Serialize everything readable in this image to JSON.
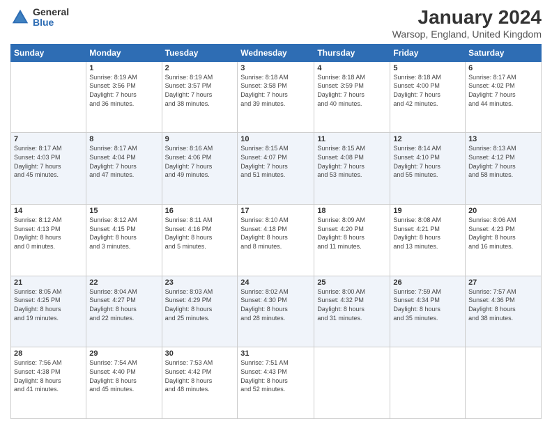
{
  "header": {
    "logo_general": "General",
    "logo_blue": "Blue",
    "month_title": "January 2024",
    "location": "Warsop, England, United Kingdom"
  },
  "days_of_week": [
    "Sunday",
    "Monday",
    "Tuesday",
    "Wednesday",
    "Thursday",
    "Friday",
    "Saturday"
  ],
  "weeks": [
    [
      {
        "day": "",
        "info": ""
      },
      {
        "day": "1",
        "info": "Sunrise: 8:19 AM\nSunset: 3:56 PM\nDaylight: 7 hours\nand 36 minutes."
      },
      {
        "day": "2",
        "info": "Sunrise: 8:19 AM\nSunset: 3:57 PM\nDaylight: 7 hours\nand 38 minutes."
      },
      {
        "day": "3",
        "info": "Sunrise: 8:18 AM\nSunset: 3:58 PM\nDaylight: 7 hours\nand 39 minutes."
      },
      {
        "day": "4",
        "info": "Sunrise: 8:18 AM\nSunset: 3:59 PM\nDaylight: 7 hours\nand 40 minutes."
      },
      {
        "day": "5",
        "info": "Sunrise: 8:18 AM\nSunset: 4:00 PM\nDaylight: 7 hours\nand 42 minutes."
      },
      {
        "day": "6",
        "info": "Sunrise: 8:17 AM\nSunset: 4:02 PM\nDaylight: 7 hours\nand 44 minutes."
      }
    ],
    [
      {
        "day": "7",
        "info": "Sunrise: 8:17 AM\nSunset: 4:03 PM\nDaylight: 7 hours\nand 45 minutes."
      },
      {
        "day": "8",
        "info": "Sunrise: 8:17 AM\nSunset: 4:04 PM\nDaylight: 7 hours\nand 47 minutes."
      },
      {
        "day": "9",
        "info": "Sunrise: 8:16 AM\nSunset: 4:06 PM\nDaylight: 7 hours\nand 49 minutes."
      },
      {
        "day": "10",
        "info": "Sunrise: 8:15 AM\nSunset: 4:07 PM\nDaylight: 7 hours\nand 51 minutes."
      },
      {
        "day": "11",
        "info": "Sunrise: 8:15 AM\nSunset: 4:08 PM\nDaylight: 7 hours\nand 53 minutes."
      },
      {
        "day": "12",
        "info": "Sunrise: 8:14 AM\nSunset: 4:10 PM\nDaylight: 7 hours\nand 55 minutes."
      },
      {
        "day": "13",
        "info": "Sunrise: 8:13 AM\nSunset: 4:12 PM\nDaylight: 7 hours\nand 58 minutes."
      }
    ],
    [
      {
        "day": "14",
        "info": "Sunrise: 8:12 AM\nSunset: 4:13 PM\nDaylight: 8 hours\nand 0 minutes."
      },
      {
        "day": "15",
        "info": "Sunrise: 8:12 AM\nSunset: 4:15 PM\nDaylight: 8 hours\nand 3 minutes."
      },
      {
        "day": "16",
        "info": "Sunrise: 8:11 AM\nSunset: 4:16 PM\nDaylight: 8 hours\nand 5 minutes."
      },
      {
        "day": "17",
        "info": "Sunrise: 8:10 AM\nSunset: 4:18 PM\nDaylight: 8 hours\nand 8 minutes."
      },
      {
        "day": "18",
        "info": "Sunrise: 8:09 AM\nSunset: 4:20 PM\nDaylight: 8 hours\nand 11 minutes."
      },
      {
        "day": "19",
        "info": "Sunrise: 8:08 AM\nSunset: 4:21 PM\nDaylight: 8 hours\nand 13 minutes."
      },
      {
        "day": "20",
        "info": "Sunrise: 8:06 AM\nSunset: 4:23 PM\nDaylight: 8 hours\nand 16 minutes."
      }
    ],
    [
      {
        "day": "21",
        "info": "Sunrise: 8:05 AM\nSunset: 4:25 PM\nDaylight: 8 hours\nand 19 minutes."
      },
      {
        "day": "22",
        "info": "Sunrise: 8:04 AM\nSunset: 4:27 PM\nDaylight: 8 hours\nand 22 minutes."
      },
      {
        "day": "23",
        "info": "Sunrise: 8:03 AM\nSunset: 4:29 PM\nDaylight: 8 hours\nand 25 minutes."
      },
      {
        "day": "24",
        "info": "Sunrise: 8:02 AM\nSunset: 4:30 PM\nDaylight: 8 hours\nand 28 minutes."
      },
      {
        "day": "25",
        "info": "Sunrise: 8:00 AM\nSunset: 4:32 PM\nDaylight: 8 hours\nand 31 minutes."
      },
      {
        "day": "26",
        "info": "Sunrise: 7:59 AM\nSunset: 4:34 PM\nDaylight: 8 hours\nand 35 minutes."
      },
      {
        "day": "27",
        "info": "Sunrise: 7:57 AM\nSunset: 4:36 PM\nDaylight: 8 hours\nand 38 minutes."
      }
    ],
    [
      {
        "day": "28",
        "info": "Sunrise: 7:56 AM\nSunset: 4:38 PM\nDaylight: 8 hours\nand 41 minutes."
      },
      {
        "day": "29",
        "info": "Sunrise: 7:54 AM\nSunset: 4:40 PM\nDaylight: 8 hours\nand 45 minutes."
      },
      {
        "day": "30",
        "info": "Sunrise: 7:53 AM\nSunset: 4:42 PM\nDaylight: 8 hours\nand 48 minutes."
      },
      {
        "day": "31",
        "info": "Sunrise: 7:51 AM\nSunset: 4:43 PM\nDaylight: 8 hours\nand 52 minutes."
      },
      {
        "day": "",
        "info": ""
      },
      {
        "day": "",
        "info": ""
      },
      {
        "day": "",
        "info": ""
      }
    ]
  ]
}
